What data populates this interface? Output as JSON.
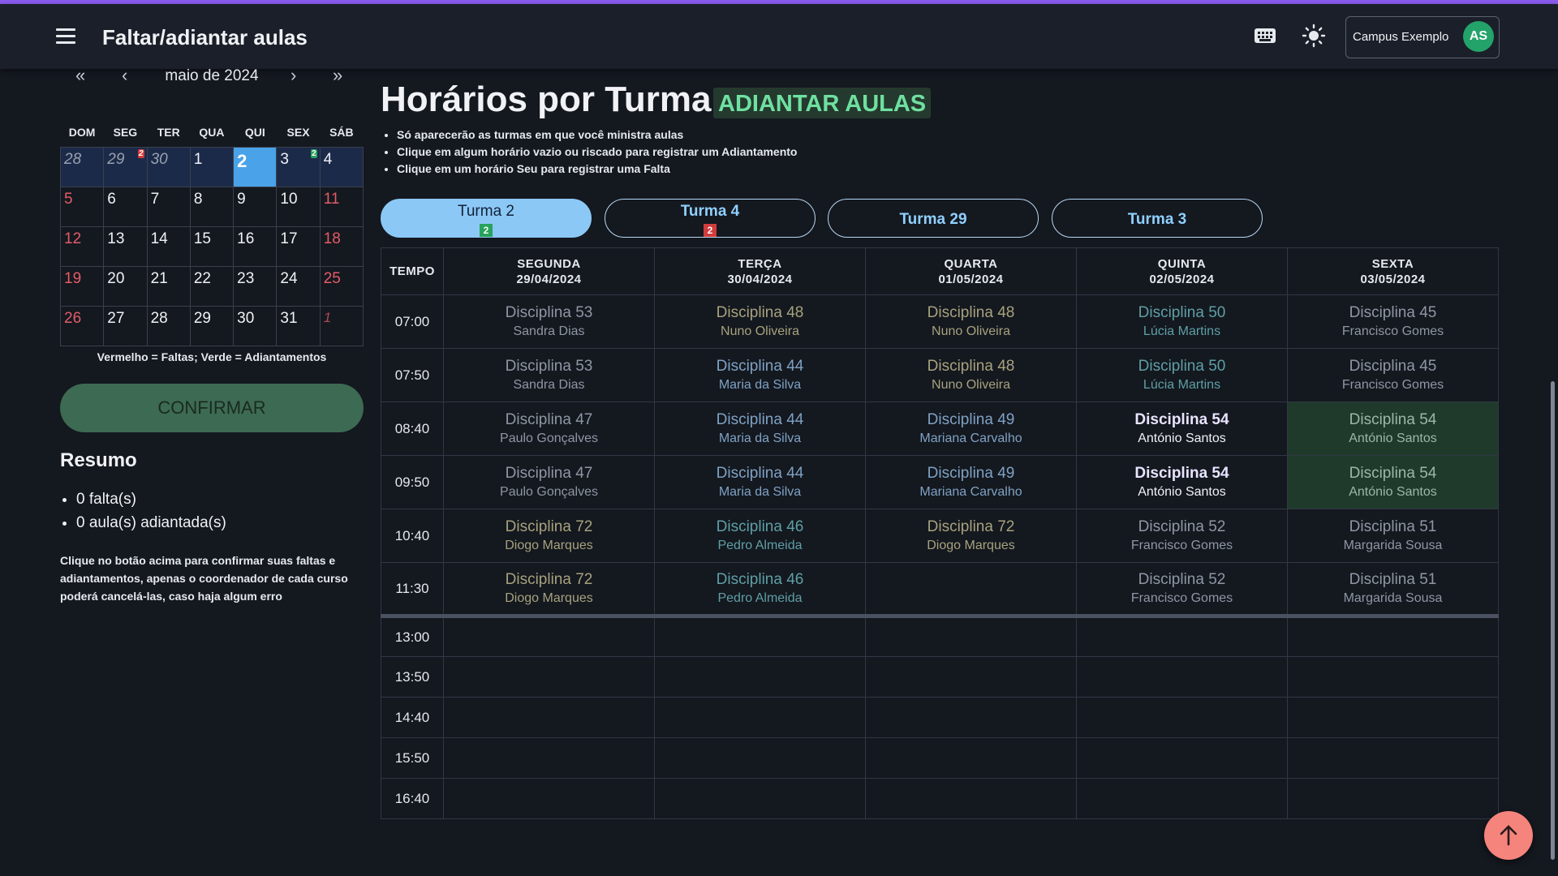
{
  "header": {
    "title": "Faltar/adiantar aulas",
    "campus": "Campus Exemplo",
    "avatar_initials": "AS",
    "accent_color": "#8a5cf0"
  },
  "calendar": {
    "month_label": "maio de 2024",
    "weekdays": [
      "DOM",
      "SEG",
      "TER",
      "QUA",
      "QUI",
      "SEX",
      "SÁB"
    ],
    "weeks": [
      [
        "28",
        "29",
        "30",
        "1",
        "2",
        "3",
        "4"
      ],
      [
        "5",
        "6",
        "7",
        "8",
        "9",
        "10",
        "11"
      ],
      [
        "12",
        "13",
        "14",
        "15",
        "16",
        "17",
        "18"
      ],
      [
        "19",
        "20",
        "21",
        "22",
        "23",
        "24",
        "25"
      ],
      [
        "26",
        "27",
        "28",
        "29",
        "30",
        "31",
        "1"
      ]
    ],
    "badges": {
      "absence_on_29": "2",
      "advance_on_3": "2"
    },
    "legend": "Vermelho = Faltas; Verde = Adiantamentos"
  },
  "confirm_label": "CONFIRMAR",
  "summary": {
    "title": "Resumo",
    "items": [
      "0 falta(s)",
      "0 aula(s) adiantada(s)"
    ],
    "note": "Clique no botão acima para confirmar suas faltas e adiantamentos, apenas o coordenador de cada curso poderá cancelá-las, caso haja algum erro"
  },
  "main": {
    "title": "Horários por Turma",
    "mode": "ADIANTAR AULAS",
    "hints": [
      "Só aparecerão as turmas em que você ministra aulas",
      "Clique em algum horário vazio ou riscado para registrar um Adiantamento",
      "Clique em um horário Seu para registrar uma Falta"
    ],
    "tabs": [
      {
        "label": "Turma 2",
        "badge": "2"
      },
      {
        "label": "Turma 4",
        "badge": "2"
      },
      {
        "label": "Turma 29"
      },
      {
        "label": "Turma 3"
      }
    ]
  },
  "schedule": {
    "time_header": "TEMPO",
    "days": [
      {
        "name": "SEGUNDA",
        "date": "29/04/2024"
      },
      {
        "name": "TERÇA",
        "date": "30/04/2024"
      },
      {
        "name": "QUARTA",
        "date": "01/05/2024"
      },
      {
        "name": "QUINTA",
        "date": "02/05/2024"
      },
      {
        "name": "SEXTA",
        "date": "03/05/2024"
      }
    ],
    "rows": [
      {
        "time": "07:00",
        "cells": [
          {
            "d": "Disciplina 53",
            "p": "Sandra Dias"
          },
          {
            "d": "Disciplina 48",
            "p": "Nuno Oliveira"
          },
          {
            "d": "Disciplina 48",
            "p": "Nuno Oliveira"
          },
          {
            "d": "Disciplina 50",
            "p": "Lúcia Martins"
          },
          {
            "d": "Disciplina 45",
            "p": "Francisco Gomes"
          }
        ]
      },
      {
        "time": "07:50",
        "cells": [
          {
            "d": "Disciplina 53",
            "p": "Sandra Dias"
          },
          {
            "d": "Disciplina 44",
            "p": "Maria da Silva"
          },
          {
            "d": "Disciplina 48",
            "p": "Nuno Oliveira"
          },
          {
            "d": "Disciplina 50",
            "p": "Lúcia Martins"
          },
          {
            "d": "Disciplina 45",
            "p": "Francisco Gomes"
          }
        ]
      },
      {
        "time": "08:40",
        "cells": [
          {
            "d": "Disciplina 47",
            "p": "Paulo Gonçalves"
          },
          {
            "d": "Disciplina 44",
            "p": "Maria da Silva"
          },
          {
            "d": "Disciplina 49",
            "p": "Mariana Carvalho"
          },
          {
            "d": "Disciplina 54",
            "p": "António Santos"
          },
          {
            "d": "Disciplina 54",
            "p": "António Santos"
          }
        ]
      },
      {
        "time": "09:50",
        "cells": [
          {
            "d": "Disciplina 47",
            "p": "Paulo Gonçalves"
          },
          {
            "d": "Disciplina 44",
            "p": "Maria da Silva"
          },
          {
            "d": "Disciplina 49",
            "p": "Mariana Carvalho"
          },
          {
            "d": "Disciplina 54",
            "p": "António Santos"
          },
          {
            "d": "Disciplina 54",
            "p": "António Santos"
          }
        ]
      },
      {
        "time": "10:40",
        "cells": [
          {
            "d": "Disciplina 72",
            "p": "Diogo Marques"
          },
          {
            "d": "Disciplina 46",
            "p": "Pedro Almeida"
          },
          {
            "d": "Disciplina 72",
            "p": "Diogo Marques"
          },
          {
            "d": "Disciplina 52",
            "p": "Francisco Gomes"
          },
          {
            "d": "Disciplina 51",
            "p": "Margarida Sousa"
          }
        ]
      },
      {
        "time": "11:30",
        "cells": [
          {
            "d": "Disciplina 72",
            "p": "Diogo Marques"
          },
          {
            "d": "Disciplina 46",
            "p": "Pedro Almeida"
          },
          {
            "d": "",
            "p": ""
          },
          {
            "d": "Disciplina 52",
            "p": "Francisco Gomes"
          },
          {
            "d": "Disciplina 51",
            "p": "Margarida Sousa"
          }
        ]
      }
    ],
    "afternoon_times": [
      "13:00",
      "13:50",
      "14:40",
      "15:50",
      "16:40"
    ]
  }
}
